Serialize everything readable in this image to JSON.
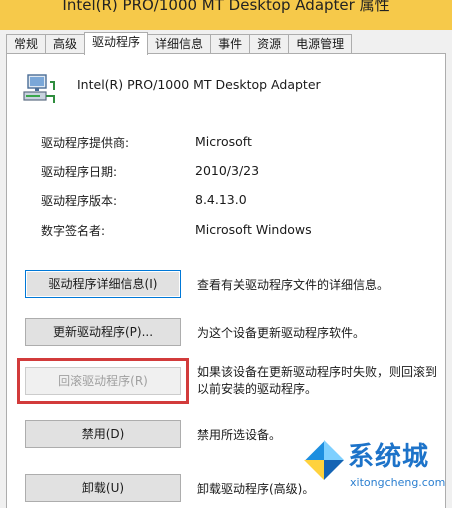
{
  "window": {
    "title": "Intel(R) PRO/1000 MT Desktop Adapter 属性"
  },
  "tabs": [
    {
      "label": "常规",
      "active": false
    },
    {
      "label": "高级",
      "active": false
    },
    {
      "label": "驱动程序",
      "active": true
    },
    {
      "label": "详细信息",
      "active": false
    },
    {
      "label": "事件",
      "active": false
    },
    {
      "label": "资源",
      "active": false
    },
    {
      "label": "电源管理",
      "active": false
    }
  ],
  "device": {
    "name": "Intel(R) PRO/1000 MT Desktop Adapter",
    "icon": "network-adapter-icon"
  },
  "driver_info": [
    {
      "key": "驱动程序提供商:",
      "value": "Microsoft"
    },
    {
      "key": "驱动程序日期:",
      "value": "2010/3/23"
    },
    {
      "key": "驱动程序版本:",
      "value": "8.4.13.0"
    },
    {
      "key": "数字签名者:",
      "value": "Microsoft Windows"
    }
  ],
  "actions": [
    {
      "label": "驱动程序详细信息(I)",
      "description": [
        "查看有关驱动程序文件的详细信息。"
      ],
      "enabled": true,
      "focused": true
    },
    {
      "label": "更新驱动程序(P)...",
      "description": [
        "为这个设备更新驱动程序软件。"
      ],
      "enabled": true,
      "focused": false
    },
    {
      "label": "回滚驱动程序(R)",
      "description": [
        "如果该设备在更新驱动程序时失败，则回滚到",
        "以前安装的驱动程序。"
      ],
      "enabled": false,
      "focused": false
    },
    {
      "label": "禁用(D)",
      "description": [
        "禁用所选设备。"
      ],
      "enabled": true,
      "focused": false
    },
    {
      "label": "卸载(U)",
      "description": [
        "卸载驱动程序(高级)。"
      ],
      "enabled": true,
      "focused": false
    }
  ],
  "highlight": {
    "color": "#d23b3b",
    "target": "回滚驱动程序(R)"
  },
  "watermark": {
    "text": "系统城",
    "url": "xitongcheng.com",
    "color": "#1d73c9"
  },
  "colors": {
    "accent": "#0078d7",
    "disabled_text": "#a0a0a0",
    "title_bar": "#f6c94a"
  }
}
